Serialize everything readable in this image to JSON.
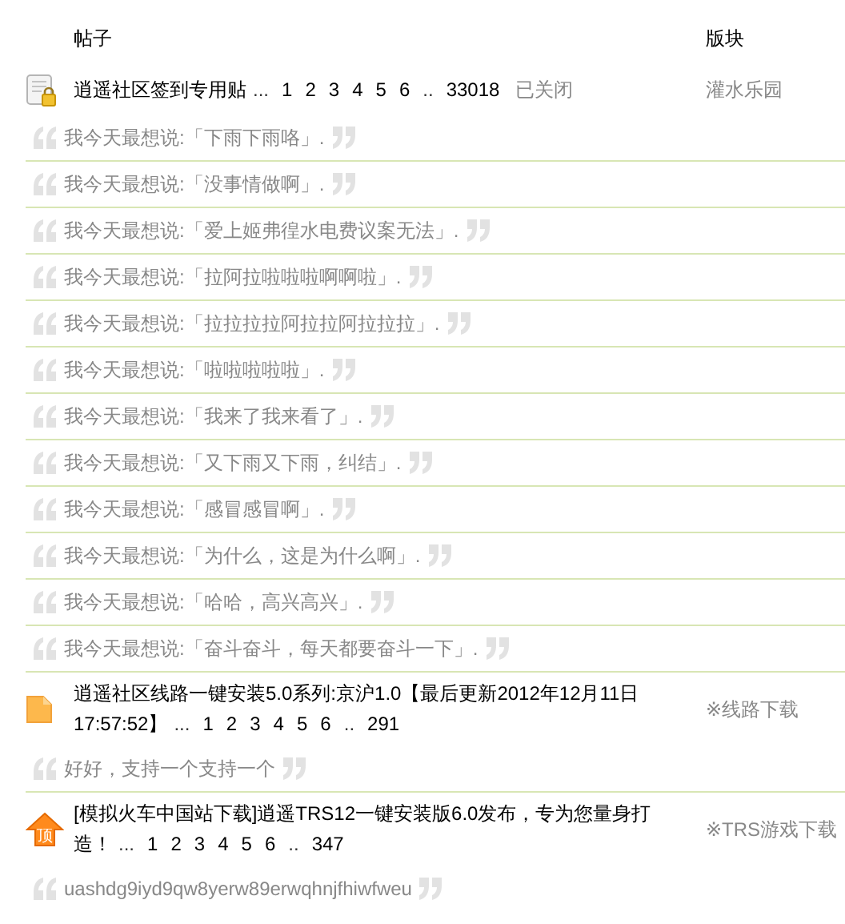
{
  "header": {
    "thread_column": "帖子",
    "forum_column": "版块"
  },
  "threads": [
    {
      "kind": "locked",
      "title": [
        "逍遥社区签到专用贴"
      ],
      "lead": "...",
      "pages": [
        "1",
        "2",
        "3",
        "4",
        "5",
        "6"
      ],
      "gap": "..",
      "last_page": "33018",
      "status": "已关闭",
      "forum": "灌水乐园",
      "quotes": [
        "我今天最想说:「下雨下雨咯」.",
        "我今天最想说:「没事情做啊」.",
        "我今天最想说:「爱上姬弗徨水电费议案无法」.",
        "我今天最想说:「拉阿拉啦啦啦啊啊啦」.",
        "我今天最想说:「拉拉拉拉阿拉拉阿拉拉拉」.",
        "我今天最想说:「啦啦啦啦啦」.",
        "我今天最想说:「我来了我来看了」.",
        "我今天最想说:「又下雨又下雨，纠结」.",
        "我今天最想说:「感冒感冒啊」.",
        "我今天最想说:「为什么，这是为什么啊」.",
        "我今天最想说:「哈哈，高兴高兴」.",
        "我今天最想说:「奋斗奋斗，每天都要奋斗一下」."
      ]
    },
    {
      "kind": "normal",
      "title": [
        "逍遥社区线路一键安装5.0系列:京沪1.0【最后更新2012年12月11日",
        "17:57:52】"
      ],
      "lead": "...",
      "pages": [
        "1",
        "2",
        "3",
        "4",
        "5",
        "6"
      ],
      "gap": "..",
      "last_page": "291",
      "forum": "※线路下载",
      "quotes": [
        "好好，支持一个支持一个"
      ]
    },
    {
      "kind": "top",
      "badge_text": "顶",
      "title": [
        "[模拟火车中国站下载]逍遥TRS12一键安装版6.0发布，专为您量身打",
        "造！"
      ],
      "lead": "...",
      "pages": [
        "1",
        "2",
        "3",
        "4",
        "5",
        "6"
      ],
      "gap": "..",
      "last_page": "347",
      "forum": "※TRS游戏下载",
      "quotes": [
        "uashdg9iyd9qw8yerw89erwqhnjfhiwfweu"
      ]
    }
  ]
}
